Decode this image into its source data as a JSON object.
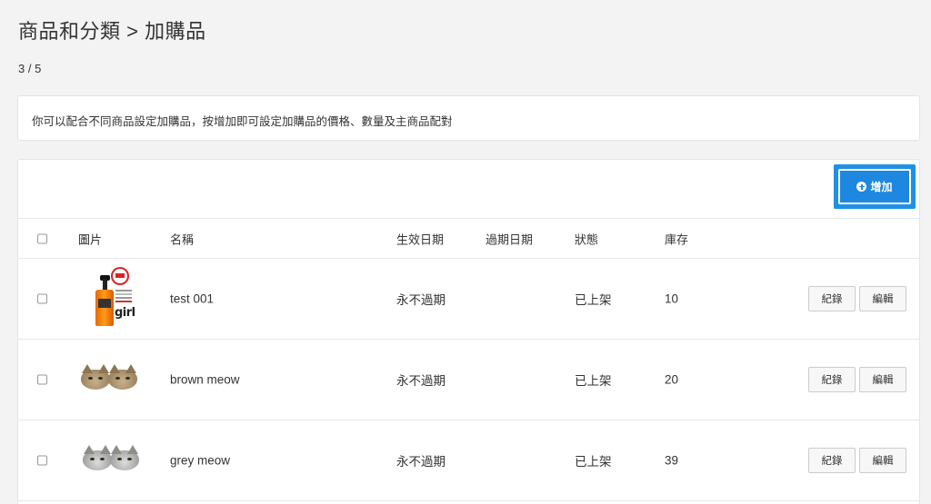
{
  "header": {
    "title": "商品和分類 > 加購品",
    "counter": "3 / 5"
  },
  "info": {
    "text": "你可以配合不同商品設定加購品，按增加即可設定加購品的價格、數量及主商品配對"
  },
  "toolbar": {
    "add_label": "增加",
    "accent_color": "#1e88e0"
  },
  "table": {
    "headers": {
      "image": "圖片",
      "name": "名稱",
      "start_date": "生效日期",
      "end_date": "過期日期",
      "status": "狀態",
      "stock": "庫存"
    },
    "rows": [
      {
        "image_icon": "serum-bottle-image",
        "thumb_text": "girl",
        "name": "test 001",
        "start_date": "永不過期",
        "end_date": "",
        "status": "已上架",
        "stock": "10",
        "log_label": "紀錄",
        "edit_label": "編輯"
      },
      {
        "image_icon": "brown-cats-image",
        "name": "brown meow",
        "start_date": "永不過期",
        "end_date": "",
        "status": "已上架",
        "stock": "20",
        "log_label": "紀錄",
        "edit_label": "編輯"
      },
      {
        "image_icon": "grey-cats-image",
        "name": "grey meow",
        "start_date": "永不過期",
        "end_date": "",
        "status": "已上架",
        "stock": "39",
        "log_label": "紀錄",
        "edit_label": "編輯"
      }
    ]
  }
}
